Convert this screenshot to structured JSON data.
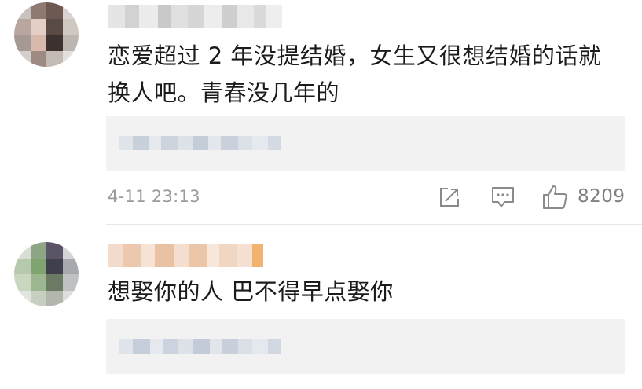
{
  "comments": [
    {
      "author_name": "",
      "text_line1": "恋爱超过 2 年没提结婚，女生又很想结婚的话就",
      "text_line2": "换人吧。青春没几年的",
      "timestamp": "4-11 23:13",
      "like_count": "8209"
    },
    {
      "author_name": "",
      "text_line1": "想娶你的人 巴不得早点娶你"
    }
  ],
  "icons": {
    "share": "share-icon",
    "reply": "comment-icon",
    "like": "thumbs-up-icon"
  },
  "colors": {
    "reply_box": "#f2f2f2",
    "meta_text": "#9a9a9a",
    "divider": "#e6e6e6"
  }
}
